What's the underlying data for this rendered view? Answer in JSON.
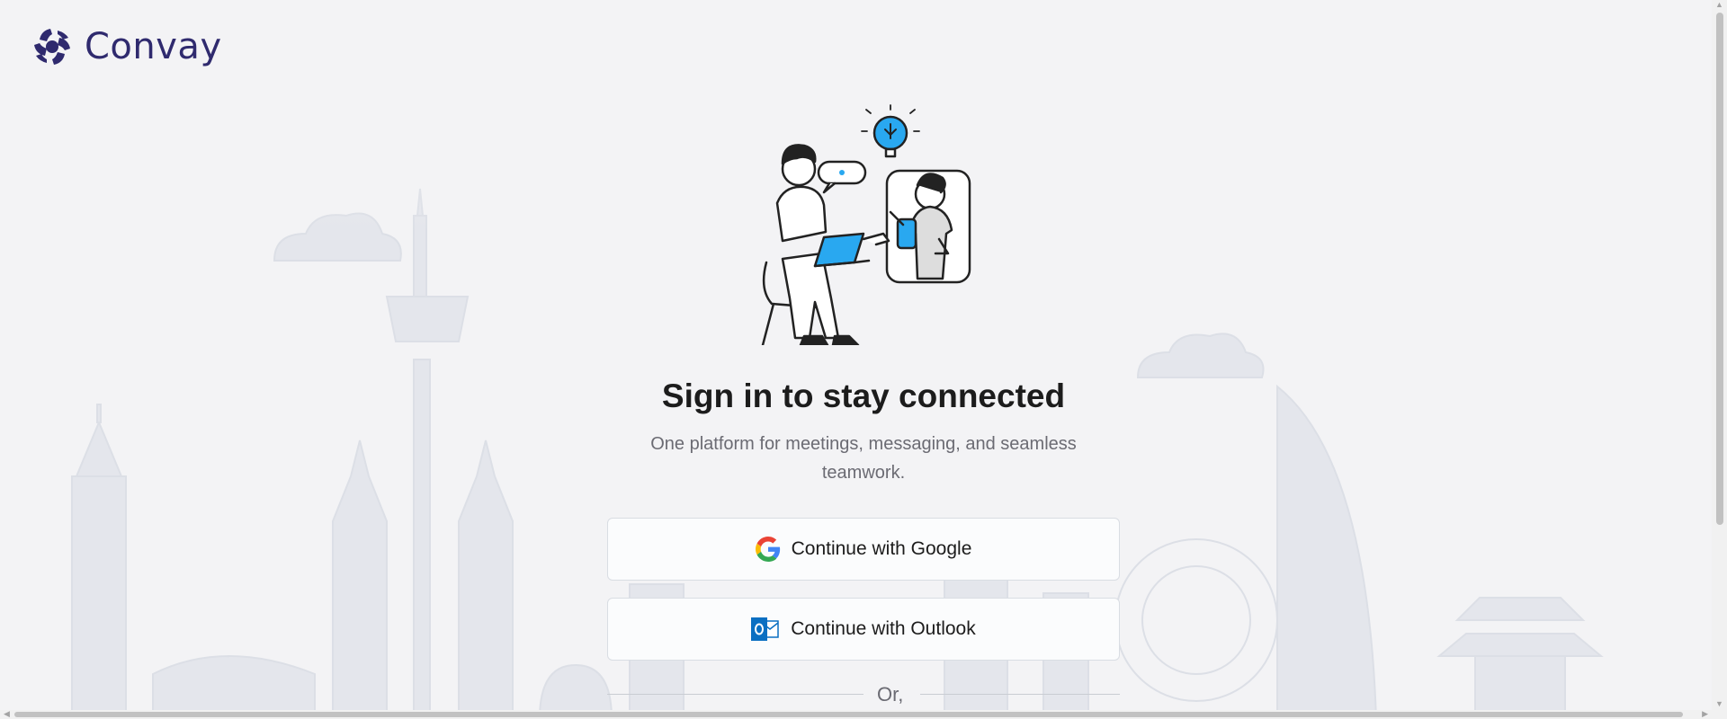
{
  "brand": {
    "name": "Convay",
    "color": "#2f2a6e"
  },
  "hero": {
    "title": "Sign in to stay connected",
    "subtitle": "One platform for meetings, messaging, and seamless teamwork."
  },
  "buttons": {
    "google_label": "Continue with Google",
    "outlook_label": "Continue with Outlook"
  },
  "divider": {
    "label": "Or,"
  },
  "icons": {
    "logo": "convay-logo-icon",
    "google": "google-icon",
    "outlook": "outlook-icon"
  },
  "colors": {
    "background": "#f3f3f5",
    "accent_blue": "#29a8f0",
    "button_border": "#d9dde3"
  }
}
